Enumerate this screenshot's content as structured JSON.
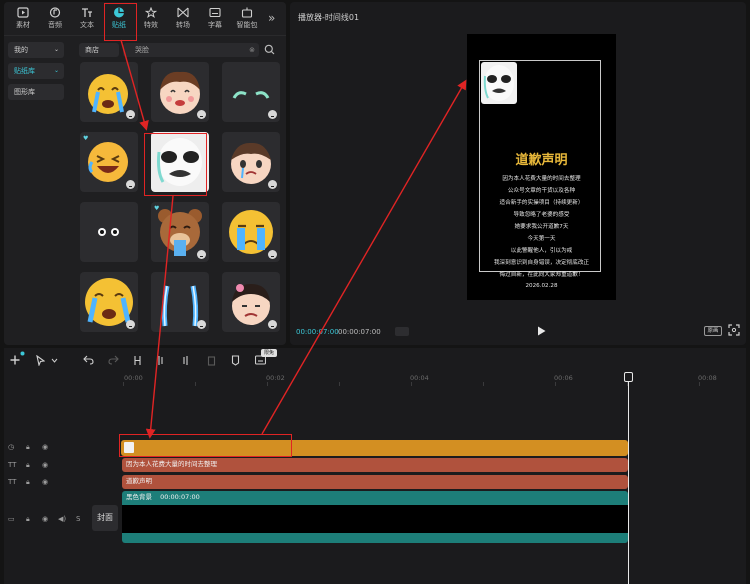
{
  "toolbar": {
    "items": [
      {
        "label": "素材",
        "icon": "media-icon"
      },
      {
        "label": "音频",
        "icon": "audio-icon"
      },
      {
        "label": "文本",
        "icon": "text-icon"
      },
      {
        "label": "贴纸",
        "icon": "sticker-icon"
      },
      {
        "label": "特效",
        "icon": "effects-icon"
      },
      {
        "label": "转场",
        "icon": "transition-icon"
      },
      {
        "label": "字幕",
        "icon": "subtitle-icon"
      },
      {
        "label": "智能包",
        "icon": "smart-package-icon"
      }
    ],
    "more": "»"
  },
  "sidebar": {
    "items": [
      {
        "label": "我的"
      },
      {
        "label": "贴纸库"
      },
      {
        "label": "图形库"
      }
    ]
  },
  "search": {
    "store_label": "商店",
    "query": "哭脸",
    "clear": "⊗"
  },
  "stickers": [
    {
      "name": "crying-yellow-emoji"
    },
    {
      "name": "crying-girl-emoji"
    },
    {
      "name": "teal-tears-sticker"
    },
    {
      "name": "laughing-crying-emoji"
    },
    {
      "name": "panda-meme-sticker"
    },
    {
      "name": "sad-boy-emoji"
    },
    {
      "name": "black-eyes-sticker"
    },
    {
      "name": "crying-bear-sticker"
    },
    {
      "name": "sobbing-yellow-emoji"
    },
    {
      "name": "wailing-yellow-emoji"
    },
    {
      "name": "tear-streams-sticker"
    },
    {
      "name": "crying-doll-sticker"
    }
  ],
  "player": {
    "title": "播放器-时间线01",
    "canvas_title": "道歉声明",
    "lines": [
      "因为本人花费大量的时间去整理",
      "公众号文章的干货以及各种",
      "适合新手的实操项目（持续更新）",
      "导致忽略了老婆的感受",
      "她要求我公开道歉7天",
      "今天第一天",
      "以此警醒他人，引以为戒",
      "我深刻意识到自身错误，决定彻底改正",
      "悔过自新，在此向大家郑重道歉！"
    ],
    "date": "2026.02.28",
    "timecode_current": "00:00:07:00",
    "timecode_total": "00:00:07:00",
    "ratio_label": "原画"
  },
  "timeline": {
    "new_badge": "限免",
    "ruler": [
      "00:00",
      "00:02",
      "00:04",
      "00:06",
      "00:08"
    ],
    "cover_label": "封面",
    "clips": {
      "text1": "因为本人花费大量的时间去整理",
      "text2": "道歉声明",
      "video_name": "黑色背景",
      "video_duration": "00:00:07:00"
    }
  },
  "colors": {
    "accent": "#3cc8d8",
    "sticker_clip": "#d38f22",
    "text_clip": "#b0523d",
    "video_clip": "#1d7e79",
    "annotation": "#e02424",
    "title_gold": "#e8b83a"
  }
}
